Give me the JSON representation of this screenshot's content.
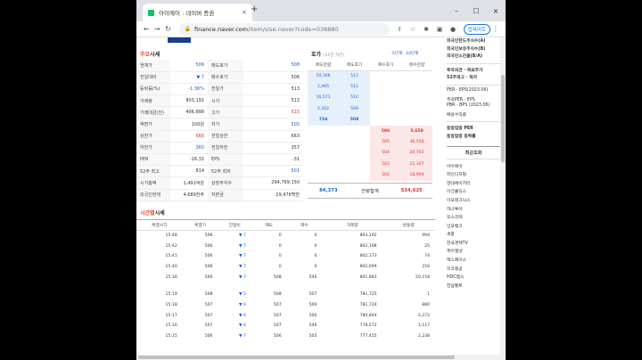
{
  "browser": {
    "tab_title": "아이에이 : 네이버 증권",
    "tab_close": "×",
    "new_tab": "+",
    "minimize": "–",
    "maximize": "☐",
    "close": "×",
    "url_host": "finance.naver.com",
    "url_path": "/item/sise.naver?code=038880",
    "update_label": "업데이트"
  },
  "quote": {
    "title_red": "주요",
    "title": "시세",
    "rows": [
      {
        "k1": "현재가",
        "v1": "506",
        "k2": "매도호가",
        "v2": "508"
      },
      {
        "k1": "전일대비",
        "v1": "▼ 7",
        "k2": "매수호가",
        "v2": "506"
      },
      {
        "k1": "등락률(%)",
        "v1": "-1.36%",
        "k2": "전일가",
        "v2": "513"
      },
      {
        "k1": "거래량",
        "v1": "803,192",
        "k2": "시가",
        "v2": "513"
      },
      {
        "k1": "거래대금(천)",
        "v1": "406,898",
        "k2": "고가",
        "v2": "515"
      },
      {
        "k1": "액면가",
        "v1": "100원",
        "k2": "저가",
        "v2": "505"
      },
      {
        "k1": "상한가",
        "v1": "666",
        "k2": "전일상한",
        "v2": "663"
      },
      {
        "k1": "하한가",
        "v1": "360",
        "k2": "전일하한",
        "v2": "357"
      },
      {
        "k1": "PER",
        "v1": "-16.32",
        "k2": "EPS",
        "v2": "-31"
      },
      {
        "k1": "52주 최고",
        "v1": "814",
        "k2": "52주 최저",
        "v2": "501"
      },
      {
        "k1": "시가총액",
        "v1": "1,491억원",
        "k2": "상장주식수",
        "v2": "294,769,150"
      },
      {
        "k1": "외국인현재",
        "v1": "4,689천주",
        "k2": "자본금",
        "v2": "29,476백만"
      }
    ]
  },
  "orderbook": {
    "title": "호가",
    "sub": "(20분 지연)",
    "links": "· 5단계  · 10단계",
    "headers": [
      "매도잔량",
      "매도호가",
      "매수호가",
      "매수잔량"
    ],
    "sell": [
      {
        "qty": "10,106",
        "price": "512"
      },
      {
        "qty": "2,465",
        "price": "511"
      },
      {
        "qty": "16,571",
        "price": "510"
      },
      {
        "qty": "5,352",
        "price": "509"
      },
      {
        "qty": "734",
        "price": "508"
      }
    ],
    "buy": [
      {
        "price": "506",
        "qty": "5,659"
      },
      {
        "price": "505",
        "qty": "36,556"
      },
      {
        "price": "504",
        "qty": "20,702"
      },
      {
        "price": "503",
        "qty": "21,107"
      },
      {
        "price": "502",
        "qty": "18,904"
      }
    ],
    "total_sell": "84,373",
    "total_label": "잔량합계",
    "total_buy": "534,625"
  },
  "history": {
    "title_red": "시간별",
    "title": "시세",
    "headers": [
      "체결시각",
      "체결가",
      "전일비",
      "매도",
      "매수",
      "거래량",
      "변동량"
    ],
    "group1": [
      {
        "t": "15:48",
        "p": "506",
        "d": "▼ 7",
        "s": "0",
        "b": "0",
        "v": "803,192",
        "c": "994"
      },
      {
        "t": "15:42",
        "p": "506",
        "d": "▼ 7",
        "s": "0",
        "b": "0",
        "v": "802,198",
        "c": "25"
      },
      {
        "t": "15:41",
        "p": "506",
        "d": "▼ 7",
        "s": "0",
        "b": "0",
        "v": "802,173",
        "c": "74"
      },
      {
        "t": "15:40",
        "p": "506",
        "d": "▼ 7",
        "s": "0",
        "b": "0",
        "v": "802,099",
        "c": "216"
      },
      {
        "t": "15:30",
        "p": "506",
        "d": "▼ 7",
        "s": "508",
        "b": "506",
        "v": "801,883",
        "c": "20,158"
      }
    ],
    "group2": [
      {
        "t": "15:19",
        "p": "508",
        "d": "▼ 5",
        "s": "508",
        "b": "507",
        "v": "781,725",
        "c": "1"
      },
      {
        "t": "15:18",
        "p": "507",
        "d": "▼ 6",
        "s": "507",
        "b": "506",
        "v": "781,724",
        "c": "880"
      },
      {
        "t": "15:17",
        "p": "507",
        "d": "▼ 6",
        "s": "507",
        "b": "506",
        "v": "780,844",
        "c": "2,272"
      },
      {
        "t": "15:16",
        "p": "507",
        "d": "▼ 6",
        "s": "507",
        "b": "506",
        "v": "778,572",
        "c": "1,117"
      },
      {
        "t": "15:15",
        "p": "506",
        "d": "▼ 7",
        "s": "506",
        "b": "505",
        "v": "777,455",
        "c": "2,238"
      }
    ]
  },
  "sidebar": {
    "top_lines": [
      "외국인한도주식수(A)",
      "외국인보유주식수(B)",
      "외국인소진율(B/A)"
    ],
    "mid_lines": [
      "투자의견 · 목표주가",
      "52주최고 · 최저"
    ],
    "per_lines": [
      "PER · EPS(2023.06)",
      "추정PER · EPS",
      "PBR · BPS (2023.06)",
      "배당수익률"
    ],
    "industry_lines": [
      "동일업종 PER",
      "동일업종 등락률"
    ],
    "recent_title": "최근조회",
    "recent": [
      "아이에이",
      "파인디지털",
      "현대에이치티",
      "이건홀딩스",
      "이오테크닉스",
      "하나투어",
      "오스코텍",
      "인포뱅크",
      "세중",
      "한국경제TV",
      "케이엘넷",
      "엑스페이스",
      "지코중공",
      "HDC랩스",
      "한섬벨트"
    ]
  }
}
